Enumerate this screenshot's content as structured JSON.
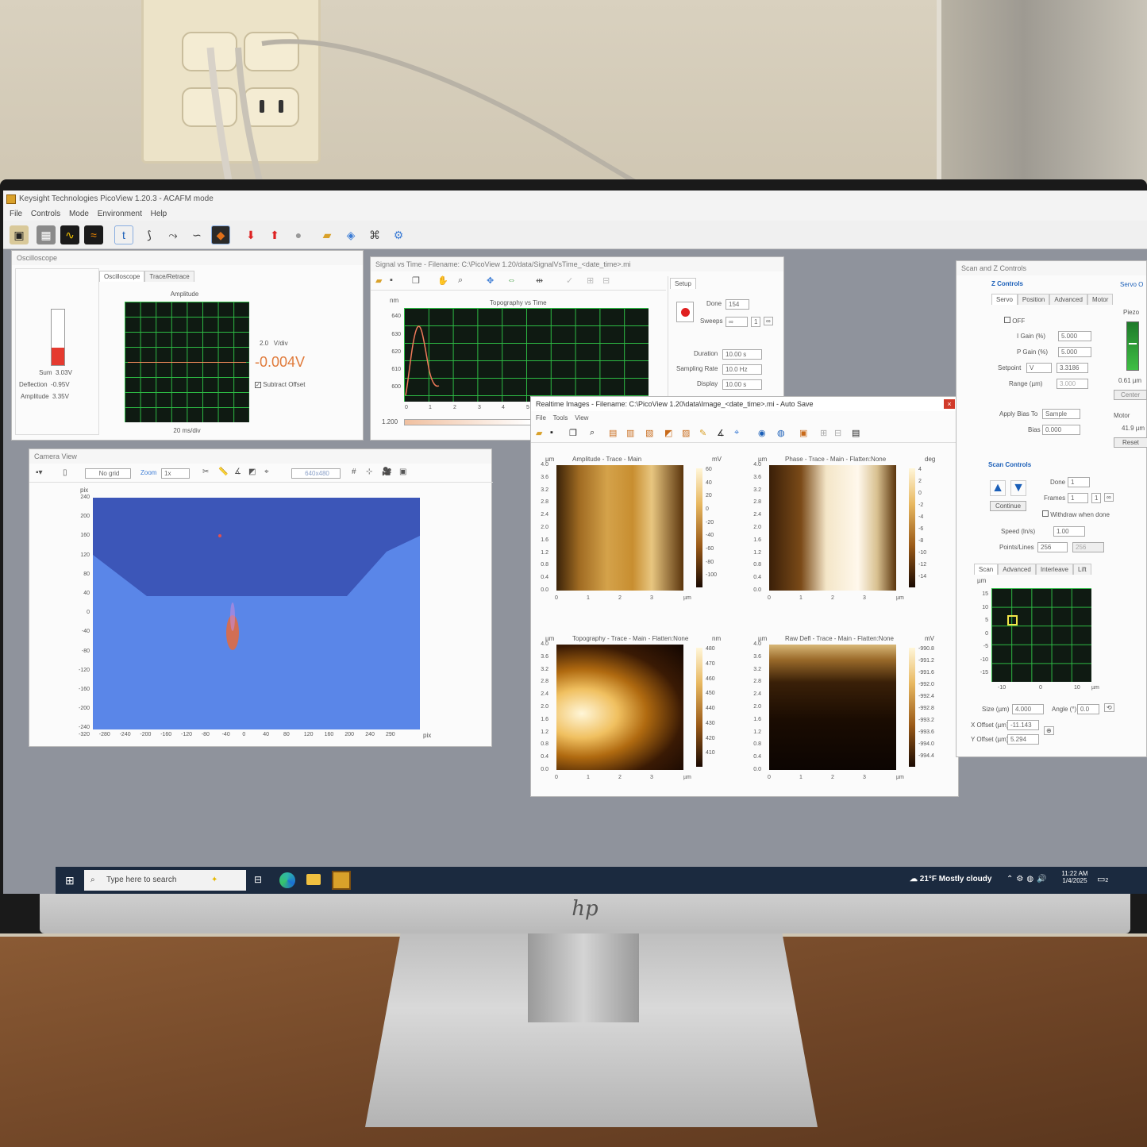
{
  "app": {
    "title": "Keysight Technologies PicoView 1.20.3 - ACAFM mode",
    "menu": [
      "File",
      "Controls",
      "Mode",
      "Environment",
      "Help"
    ]
  },
  "toolbar_icons": [
    "instrument-icon",
    "grid-layout-icon",
    "oscilloscope-icon",
    "signal-icon",
    "trace-time-icon",
    "spectroscopy-icon",
    "tune-icon",
    "sweep-icon",
    "image-icon",
    "approach-down-icon",
    "withdraw-up-icon",
    "stop-icon",
    "open-folder-icon",
    "export-icon",
    "calibration-icon",
    "settings-gear-icon"
  ],
  "oscilloscope": {
    "title": "Oscilloscope",
    "tabs": [
      "Oscilloscope",
      "Trace/Retrace"
    ],
    "sum_label": "Sum",
    "sum_value": "3.03V",
    "deflection_label": "Deflection",
    "deflection_value": "-0.95V",
    "amplitude_label": "Amplitude",
    "amplitude_value": "3.35V",
    "plot_title": "Amplitude",
    "vdiv_value": "2.0",
    "vdiv_unit": "V/div",
    "reading": "-0.004V",
    "subtract_offset": "Subtract Offset",
    "time_div": "20 ms/div",
    "sum_bar_level": 0.32
  },
  "signal_vs_time": {
    "title": "Signal vs Time - Filename: C:\\PicoView 1.20/data/SignalVsTime_<date_time>.mi",
    "plot_title": "Topography  vs  Time",
    "y_unit": "nm",
    "y_ticks": [
      "640",
      "630",
      "620",
      "610",
      "600"
    ],
    "x_ticks": [
      "0",
      "1",
      "2",
      "3",
      "4",
      "5"
    ],
    "bottom_value": "1.200",
    "setup_tab": "Setup",
    "done_label": "Done",
    "done_value": "154",
    "sweeps_label": "Sweeps",
    "sweeps_value": "∞",
    "sweeps_count": "1",
    "duration_label": "Duration",
    "duration_value": "10.00 s",
    "sampling_label": "Sampling Rate",
    "sampling_value": "10.0 Hz",
    "display_label": "Display",
    "display_value": "10.00 s"
  },
  "camera": {
    "title": "Camera View",
    "grid_select": "No grid",
    "zoom_label": "Zoom",
    "zoom_value": "1x",
    "resolution": "640x480",
    "y_unit": "pix",
    "y_ticks": [
      "240",
      "200",
      "160",
      "120",
      "80",
      "40",
      "0",
      "-40",
      "-80",
      "-120",
      "-160",
      "-200",
      "-240"
    ],
    "x_ticks": [
      "-320",
      "-280",
      "-240",
      "-200",
      "-160",
      "-120",
      "-80",
      "-40",
      "0",
      "40",
      "80",
      "120",
      "160",
      "200",
      "240",
      "290"
    ],
    "x_unit": "pix"
  },
  "realtime": {
    "title": "Realtime Images - Filename: C:\\PicoView 1.20\\data\\Image_<date_time>.mi - Auto Save",
    "menu": [
      "File",
      "Tools",
      "View"
    ],
    "images": [
      {
        "label": "Amplitude - Trace - Main",
        "unit_left": "µm",
        "unit_right": "mV",
        "scale": [
          "60",
          "40",
          "20",
          "0",
          "-20",
          "-40",
          "-60",
          "-80",
          "-100"
        ]
      },
      {
        "label": "Phase - Trace - Main - Flatten:None",
        "unit_left": "µm",
        "unit_right": "deg",
        "scale": [
          "4",
          "2",
          "0",
          "-2",
          "-4",
          "-6",
          "-8",
          "-10",
          "-12",
          "-14"
        ]
      },
      {
        "label": "Topography - Trace - Main - Flatten:None",
        "unit_left": "µm",
        "unit_right": "nm",
        "scale": [
          "480",
          "470",
          "460",
          "450",
          "440",
          "430",
          "420",
          "410"
        ]
      },
      {
        "label": "Raw Defl - Trace - Main - Flatten:None",
        "unit_left": "µm",
        "unit_right": "mV",
        "scale": [
          "-990.8",
          "-991.2",
          "-991.6",
          "-992.0",
          "-992.4",
          "-992.8",
          "-993.2",
          "-993.6",
          "-994.0",
          "-994.4"
        ]
      }
    ],
    "y_ticks": [
      "4.0",
      "3.6",
      "3.2",
      "2.8",
      "2.4",
      "2.0",
      "1.6",
      "1.2",
      "0.8",
      "0.4",
      "0.0"
    ],
    "x_ticks": [
      "0",
      "1",
      "2",
      "3"
    ],
    "x_unit": "µm"
  },
  "scan_z": {
    "title": "Scan and Z Controls",
    "z_section": "Z Controls",
    "servo_label": "Servo O",
    "tabs": [
      "Servo",
      "Position",
      "Advanced",
      "Motor"
    ],
    "off_label": "OFF",
    "igain_label": "I Gain (%)",
    "igain_value": "5.000",
    "pgain_label": "P Gain (%)",
    "pgain_value": "5.000",
    "setpoint_label": "Setpoint",
    "setpoint_unit": "V",
    "setpoint_value": "3.3186",
    "range_label": "Range (µm)",
    "range_value": "3.000",
    "piezo_label": "Piezo",
    "piezo_value": "0.61 µm",
    "center_button": "Center",
    "apply_bias_label": "Apply Bias To",
    "apply_bias_value": "Sample",
    "bias_label": "Bias (V)",
    "bias_value": "0.000",
    "motor_label": "Motor",
    "motor_value": "41.9 µm",
    "reset_button": "Reset",
    "scan_section": "Scan Controls",
    "done_label": "Done",
    "done_value": "1",
    "frames_label": "Frames",
    "frames_value": "1",
    "frames_count": "1",
    "continue_button": "Continue",
    "withdraw_label": "Withdraw when done",
    "speed_label": "Speed (ln/s)",
    "speed_value": "1.00",
    "points_label": "Points/Lines",
    "points_value": "256",
    "lines_value": "256",
    "scan_tabs": [
      "Scan",
      "Advanced",
      "Interleave",
      "Lift"
    ],
    "map_unit": "µm",
    "map_y_ticks": [
      "15",
      "10",
      "5",
      "0",
      "-5",
      "-10",
      "-15"
    ],
    "map_x_ticks": [
      "-10",
      "0",
      "10"
    ],
    "size_label": "Size (µm)",
    "size_value": "4.000",
    "angle_label": "Angle (°)",
    "angle_value": "0.0",
    "xoffset_label": "X Offset (µm)",
    "xoffset_value": "-11.143",
    "yoffset_label": "Y Offset (µm)",
    "yoffset_value": "5.294"
  },
  "taskbar": {
    "search_placeholder": "Type here to search",
    "weather": "21°F  Mostly cloudy",
    "time": "11:22 AM",
    "date": "1/4/2025",
    "notification_count": "2"
  },
  "colors": {
    "accent_scope": "#2dbb44",
    "reading": "#e07a3a",
    "desktop": "#8f939c",
    "taskbar": "#1b2a3f",
    "camera_blue": "#5a86e8"
  }
}
